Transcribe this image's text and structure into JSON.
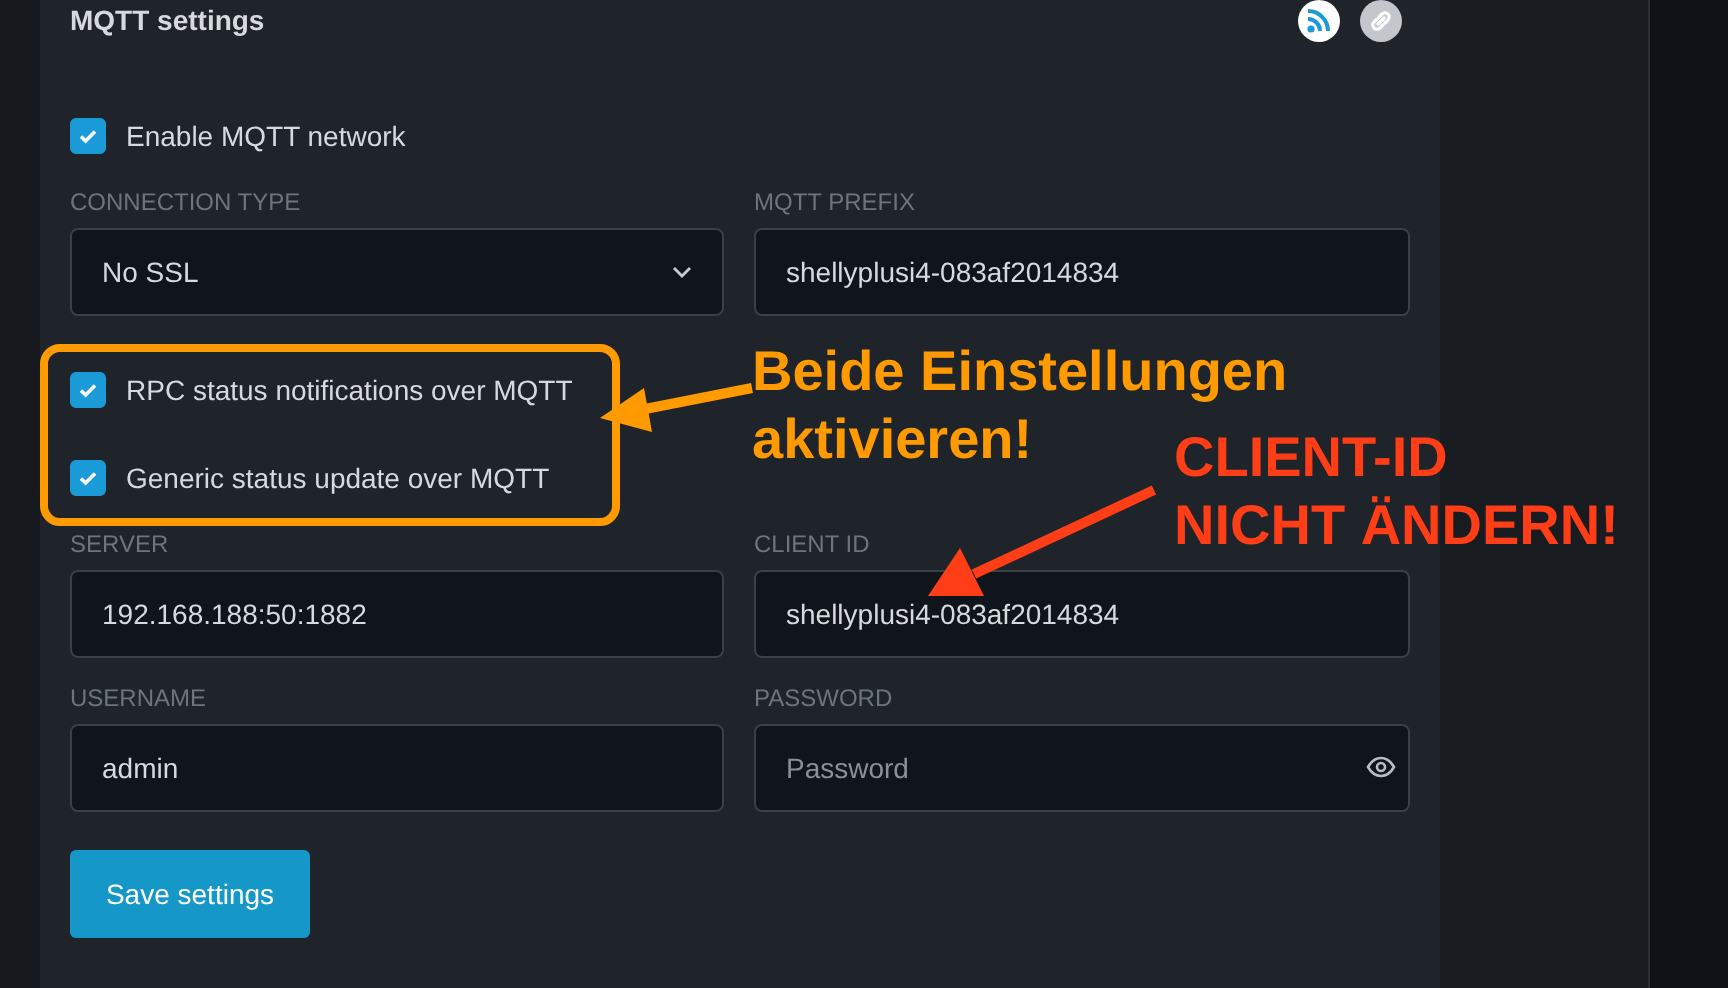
{
  "panel": {
    "title": "MQTT settings"
  },
  "enable": {
    "label": "Enable MQTT network",
    "checked": true
  },
  "connection_type": {
    "label": "CONNECTION TYPE",
    "value": "No SSL"
  },
  "mqtt_prefix": {
    "label": "MQTT PREFIX",
    "value": "shellyplusi4-083af2014834"
  },
  "notifications": [
    {
      "label": "RPC status notifications over MQTT",
      "checked": true
    },
    {
      "label": "Generic status update over MQTT",
      "checked": true
    }
  ],
  "server": {
    "label": "SERVER",
    "value": "192.168.188:50:1882"
  },
  "client_id": {
    "label": "CLIENT ID",
    "value": "shellyplusi4-083af2014834"
  },
  "username": {
    "label": "USERNAME",
    "value": "admin"
  },
  "password": {
    "label": "PASSWORD",
    "placeholder": "Password"
  },
  "save_button": "Save settings",
  "annotations": [
    {
      "lines": [
        "Beide Einstellungen",
        "aktivieren!"
      ],
      "color": "#ff9a00"
    },
    {
      "lines": [
        "CLIENT-ID",
        "NICHT ÄNDERN!"
      ],
      "color": "#ff3d17"
    }
  ]
}
